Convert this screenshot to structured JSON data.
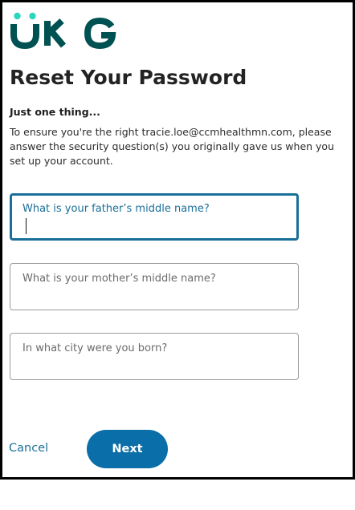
{
  "brand": {
    "logo_text": "UKG",
    "logo_color": "#005151",
    "logo_dot_color": "#2bd6c1"
  },
  "page": {
    "title": "Reset Your Password",
    "subheading": "Just one thing...",
    "instructions": "To ensure you're the right tracie.loe@ccmhealthmn.com, please answer the security question(s) you originally gave us when you set up your account."
  },
  "questions": [
    {
      "label": "What is your father’s middle name?",
      "value": "",
      "focused": true
    },
    {
      "label": "What is your mother’s middle name?",
      "value": "",
      "focused": false
    },
    {
      "label": "In what city were you born?",
      "value": "",
      "focused": false
    }
  ],
  "actions": {
    "cancel_label": "Cancel",
    "next_label": "Next"
  },
  "colors": {
    "accent": "#1a6f99",
    "button": "#0a6ea8"
  }
}
